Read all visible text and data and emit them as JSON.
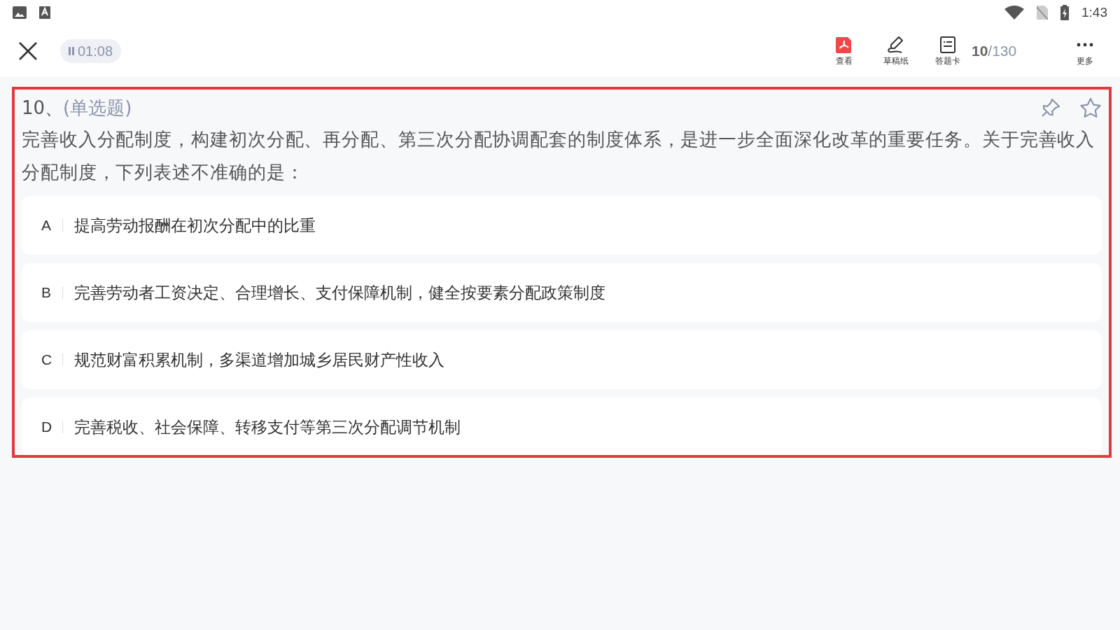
{
  "status_bar": {
    "time": "1:43"
  },
  "toolbar": {
    "timer": "01:08",
    "tools": [
      {
        "kind": "pdf",
        "label": "查看"
      },
      {
        "kind": "pen",
        "label": "草稿纸"
      },
      {
        "kind": "card",
        "label": "答题卡"
      }
    ],
    "progress_current": "10",
    "progress_total": "/130",
    "more_label": "更多"
  },
  "question": {
    "highlighted": true,
    "number": "10、",
    "type": "(单选题)",
    "text": "完善收入分配制度，构建初次分配、再分配、第三次分配协调配套的制度体系，是进一步全面深化改革的重要任务。关于完善收入分配制度，下列表述不准确的是：",
    "options": [
      {
        "letter": "A",
        "text": "提高劳动报酬在初次分配中的比重"
      },
      {
        "letter": "B",
        "text": "完善劳动者工资决定、合理增长、支付保障机制，健全按要素分配政策制度"
      },
      {
        "letter": "C",
        "text": "规范财富积累机制，多渠道增加城乡居民财产性收入"
      },
      {
        "letter": "D",
        "text": "完善税收、社会保障、转移支付等第三次分配调节机制"
      }
    ]
  }
}
